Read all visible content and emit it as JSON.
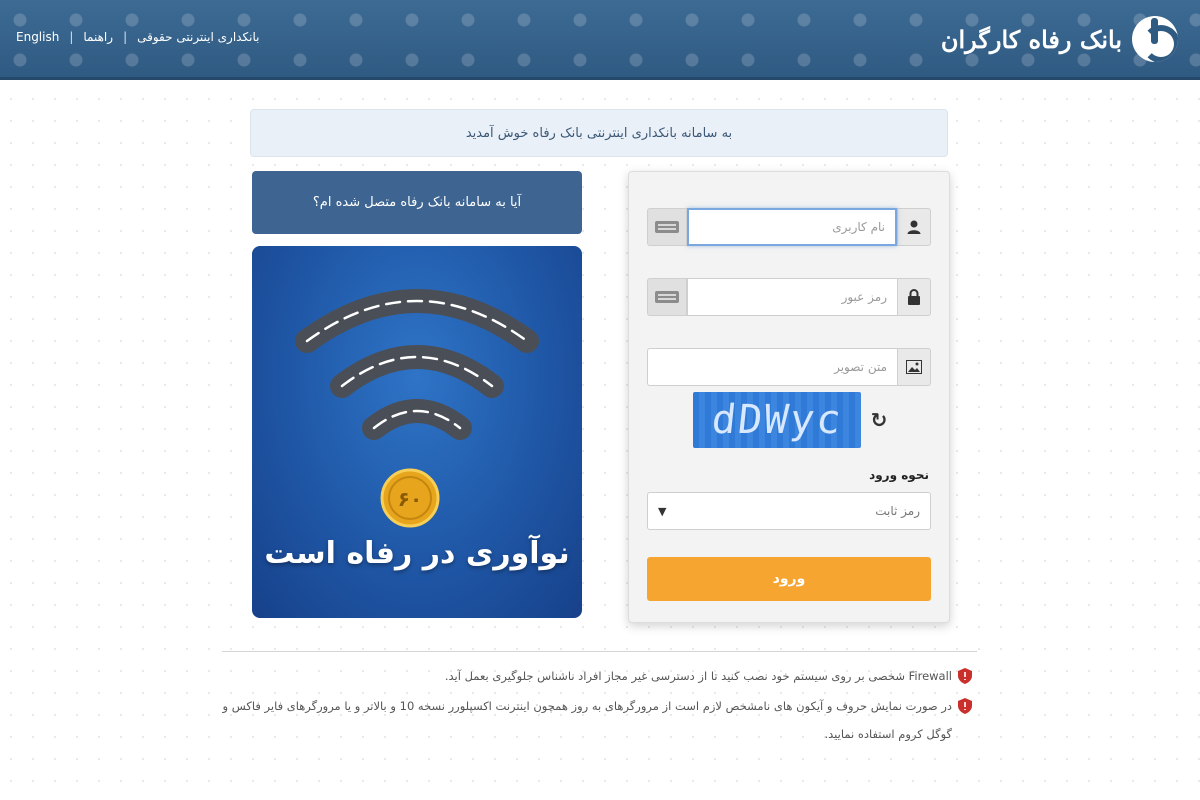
{
  "header": {
    "brand_name": "بانک رفاه کارگران",
    "links": {
      "english": "English",
      "guide": "راهنما",
      "corporate_banking": "بانکداری اینترنتی حقوقی"
    }
  },
  "welcome": {
    "text": "به سامانه بانکداری اینترنتی بانک رفاه خوش آمدید"
  },
  "connected_check": {
    "label": "آیا به سامانه بانک رفاه متصل شده ام؟"
  },
  "promo": {
    "caption": "نوآوری در رفاه است",
    "coin_text": "۶۰"
  },
  "login_form": {
    "username_placeholder": "نام کاربری",
    "password_placeholder": "رمز عبور",
    "captcha_placeholder": "متن تصویر",
    "captcha_text": "dDWyc",
    "login_method_label": "نحوه ورود",
    "login_method_value": "رمز ثابت",
    "submit_label": "ورود"
  },
  "notices": [
    "Firewall شخصی بر روی سیستم خود نصب کنید تا از دسترسی غیر مجاز افراد ناشناس جلوگیری بعمل آید.",
    "در صورت نمایش حروف و آیکون های نامشخص لازم است از مرورگرهای به روز همچون اینترنت اکسپلورر نسخه 10 و بالاتر و یا مرورگرهای فایر فاکس و گوگل کروم استفاده نمایید."
  ],
  "colors": {
    "header": "#2f5a82",
    "accent_button": "#f5a530",
    "connected_button": "#3e6591"
  },
  "icons": {
    "username": "user-icon",
    "password": "lock-icon",
    "captcha": "image-icon",
    "refresh": "refresh-icon",
    "keyboard": "keyboard-icon",
    "notice": "shield-icon"
  }
}
